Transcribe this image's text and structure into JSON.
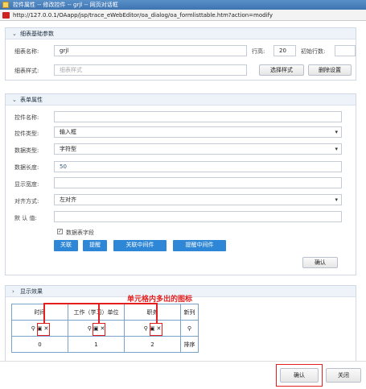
{
  "window": {
    "title": "控件属性 -- 修改控件 -- grjl -- 网页对话框",
    "url": "http://127.0.0.1/OAapp/jsp/trace_eWebEditor/oa_dialog/oa_formlisttable.htm?action=modify"
  },
  "basic": {
    "title": "细表基础参数",
    "name_label": "细表名称:",
    "name_value": "grjl",
    "height_label": "行高:",
    "height_value": "20",
    "init_rows_label": "初始行数:",
    "init_rows_value": "",
    "style_label": "细表样式:",
    "style_placeholder": "细表样式",
    "select_style": "选择样式",
    "delete_setting": "删除设置"
  },
  "props": {
    "title": "表单属性",
    "ctrl_name_label": "控件名称:",
    "ctrl_name_value": "",
    "ctrl_type_label": "控件类型:",
    "ctrl_type_value": "输入框",
    "data_type_label": "数据类型:",
    "data_type_value": "字符型",
    "data_len_label": "数据长度:",
    "data_len_value": "50",
    "display_width_label": "显示宽度:",
    "display_width_value": "",
    "align_label": "对齐方式:",
    "align_value": "左对齐",
    "default_label": "默 认 值:",
    "default_value": "",
    "sum_label": "数据表字段",
    "btn_link": "关联",
    "btn_remind": "提醒",
    "btn_link_mid": "关联中间件",
    "btn_remind_mid": "提醒中间件",
    "btn_confirm": "确认"
  },
  "preview": {
    "title": "显示效果",
    "annotation": "单元格内多出的图标",
    "headers": [
      "时间",
      "工作（学习）单位",
      "职务",
      "新列"
    ],
    "numbers": [
      "0",
      "1",
      "2"
    ],
    "sort_label": "排序"
  },
  "footer": {
    "confirm": "确认",
    "close": "关闭"
  }
}
